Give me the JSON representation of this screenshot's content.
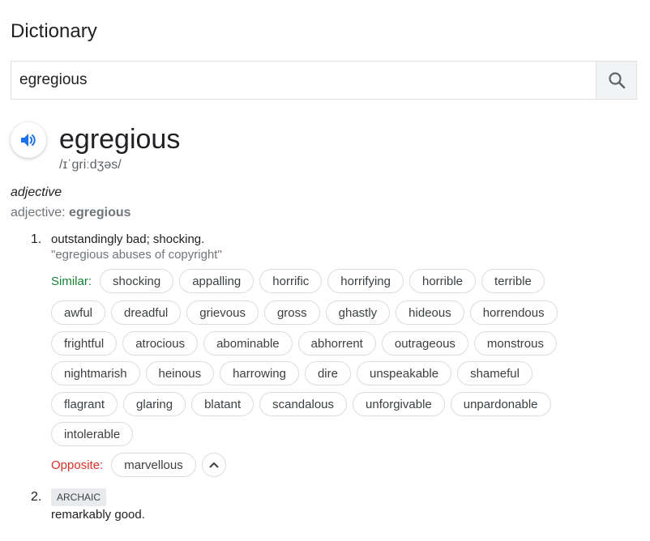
{
  "header": {
    "title": "Dictionary"
  },
  "search": {
    "value": "egregious",
    "button_icon": "search-icon"
  },
  "entry": {
    "word": "egregious",
    "phonetic": "/ɪˈɡriːdʒəs/",
    "audio_icon": "speaker-icon",
    "part_of_speech": "adjective",
    "pos_prefix": "adjective: ",
    "pos_word": "egregious",
    "senses": [
      {
        "number": "1.",
        "definition": "outstandingly bad; shocking.",
        "example": "\"egregious abuses of copyright\"",
        "similar_label": "Similar:",
        "similar": [
          "shocking",
          "appalling",
          "horrific",
          "horrifying",
          "horrible",
          "terrible",
          "awful",
          "dreadful",
          "grievous",
          "gross",
          "ghastly",
          "hideous",
          "horrendous",
          "frightful",
          "atrocious",
          "abominable",
          "abhorrent",
          "outrageous",
          "monstrous",
          "nightmarish",
          "heinous",
          "harrowing",
          "dire",
          "unspeakable",
          "shameful",
          "flagrant",
          "glaring",
          "blatant",
          "scandalous",
          "unforgivable",
          "unpardonable",
          "intolerable"
        ],
        "opposite_label": "Opposite:",
        "opposite": [
          "marvellous"
        ],
        "collapse_icon": "chevron-up-icon"
      },
      {
        "number": "2.",
        "tag": "ARCHAIC",
        "definition": "remarkably good."
      }
    ]
  },
  "colors": {
    "similar": "#188038",
    "opposite": "#d93025",
    "accent": "#1a73e8"
  }
}
